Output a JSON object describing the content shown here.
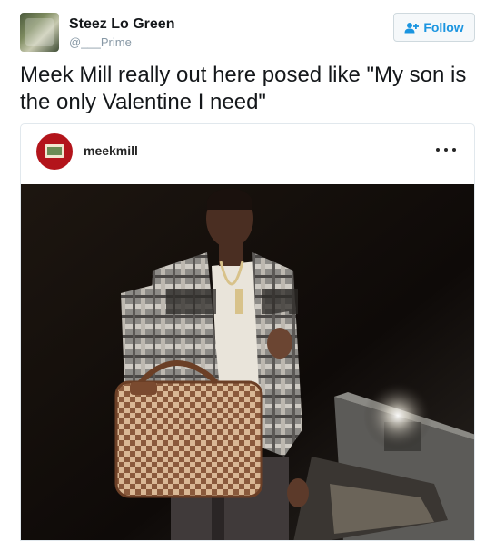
{
  "tweet": {
    "display_name": "Steez Lo Green",
    "handle": "@___Prime",
    "follow_label": "Follow",
    "text": "Meek Mill really out here posed like \"My son is the only Valentine I need\""
  },
  "embed": {
    "username": "meekmill"
  },
  "colors": {
    "accent": "#1b95e0",
    "ig_avatar": "#b3141b"
  },
  "icons": {
    "follow": "add-user-icon",
    "more": "more-options-icon"
  }
}
